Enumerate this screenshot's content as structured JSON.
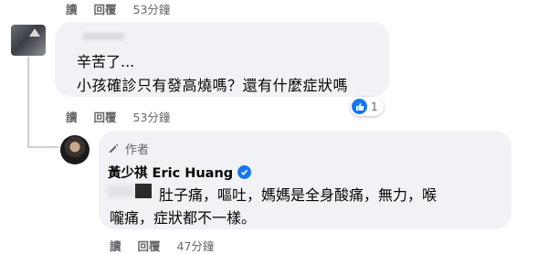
{
  "top_actions": {
    "read": "讀",
    "reply": "回覆",
    "time": "53分鐘"
  },
  "comment1": {
    "line1": "辛苦了...",
    "line2": "小孩確診只有發高燒嗎？還有什麼症狀嗎",
    "reaction_count": "1",
    "actions": {
      "read": "讀",
      "reply": "回覆",
      "time": "53分鐘"
    }
  },
  "reply": {
    "author_badge": "作者",
    "name": "黃少祺 Eric Huang",
    "line1": "肚子痛，嘔吐，媽媽是全身酸痛，無力，喉",
    "line2": "嚨痛，症狀都不一樣。",
    "actions": {
      "read": "讀",
      "reply": "回覆",
      "time": "47分鐘"
    }
  },
  "colors": {
    "bubble": "#f0f2f5",
    "accent": "#1877f2",
    "meta": "#65676b"
  },
  "icons": [
    "like-icon",
    "pencil-icon",
    "verified-icon"
  ]
}
